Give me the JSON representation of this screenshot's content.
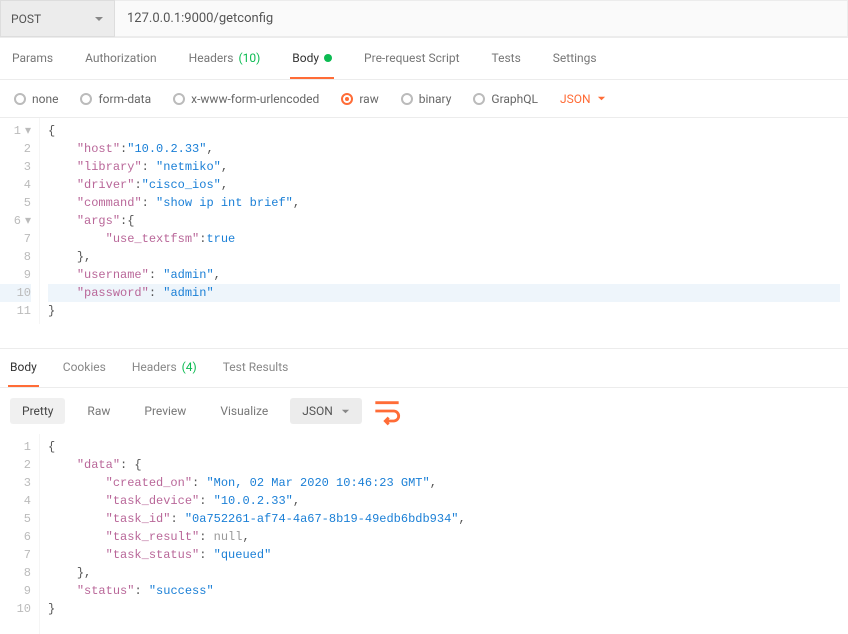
{
  "request": {
    "method": "POST",
    "url": "127.0.0.1:9000/getconfig"
  },
  "tabs": {
    "params": "Params",
    "auth": "Authorization",
    "headers": "Headers",
    "headers_count": "(10)",
    "body": "Body",
    "prerequest": "Pre-request Script",
    "tests": "Tests",
    "settings": "Settings"
  },
  "bodyopts": {
    "none": "none",
    "formdata": "form-data",
    "xwww": "x-www-form-urlencoded",
    "raw": "raw",
    "binary": "binary",
    "graphql": "GraphQL",
    "json_label": "JSON"
  },
  "req_body": {
    "L1": "{",
    "L2": "    \"host\":\"10.0.2.33\",",
    "L3": "    \"library\": \"netmiko\",",
    "L4": "    \"driver\":\"cisco_ios\",",
    "L5": "    \"command\": \"show ip int brief\",",
    "L6": "    \"args\":{",
    "L7": "        \"use_textfsm\":true",
    "L8": "    },",
    "L9": "    \"username\": \"admin\",",
    "L10": "    \"password\": \"admin\"",
    "L11": "}"
  },
  "req_keys": {
    "host": "host",
    "library": "library",
    "driver": "driver",
    "command": "command",
    "args": "args",
    "use_textfsm": "use_textfsm",
    "username": "username",
    "password": "password"
  },
  "req_vals": {
    "host": "10.0.2.33",
    "library": "netmiko",
    "driver": "cisco_ios",
    "command": "show ip int brief",
    "true": "true",
    "admin": "admin"
  },
  "lowtabs": {
    "body": "Body",
    "cookies": "Cookies",
    "headers": "Headers",
    "headers_count": "(4)",
    "testresults": "Test Results"
  },
  "viewctl": {
    "pretty": "Pretty",
    "raw": "Raw",
    "preview": "Preview",
    "visualize": "Visualize",
    "json": "JSON"
  },
  "resp_keys": {
    "data": "data",
    "created_on": "created_on",
    "task_device": "task_device",
    "task_id": "task_id",
    "task_result": "task_result",
    "task_status": "task_status",
    "status": "status"
  },
  "resp_vals": {
    "created_on": "Mon, 02 Mar 2020 10:46:23 GMT",
    "task_device": "10.0.2.33",
    "task_id": "0a752261-af74-4a67-8b19-49edb6bdb934",
    "null": "null",
    "task_status": "queued",
    "status": "success"
  }
}
